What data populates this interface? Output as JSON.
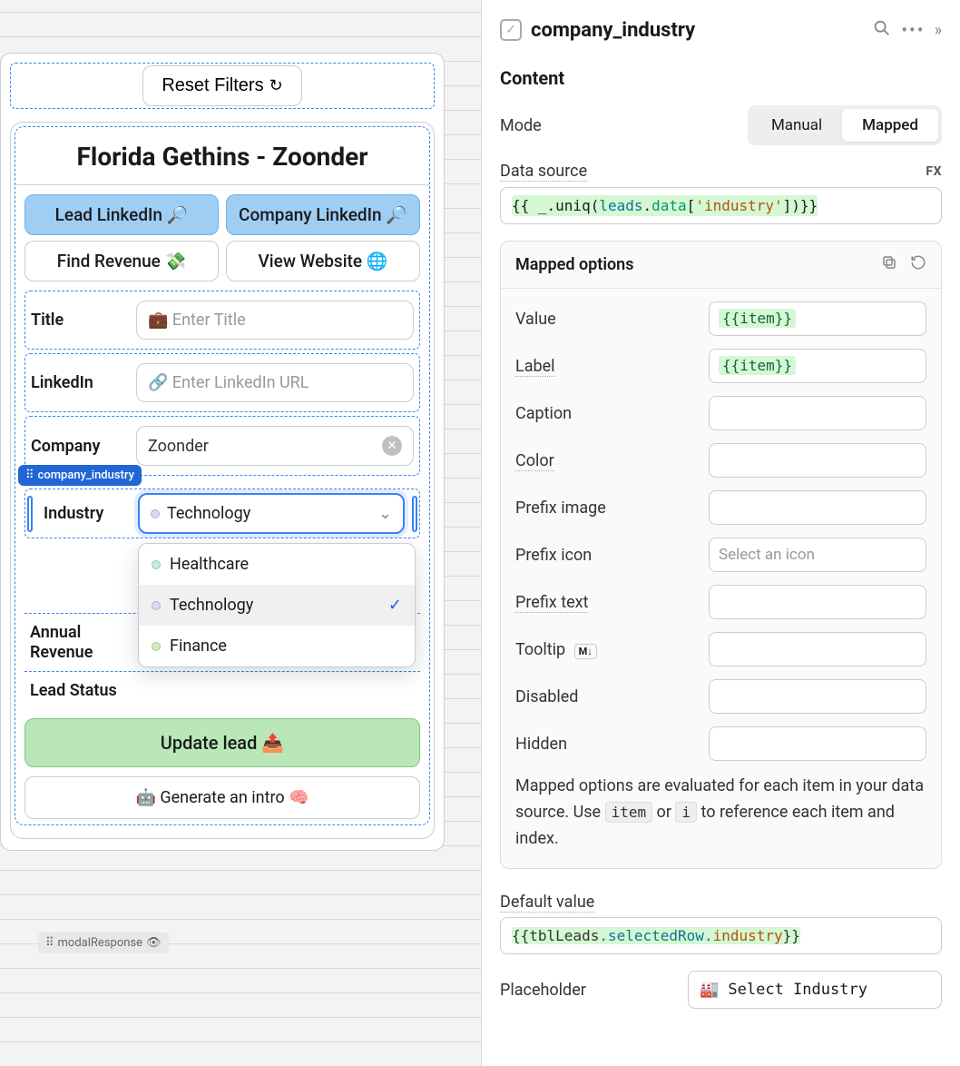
{
  "left": {
    "reset_label": "Reset Filters",
    "card_title": "Florida Gethins - Zoonder",
    "buttons": {
      "lead_linkedin": "Lead LinkedIn 🔎",
      "company_linkedin": "Company LinkedIn 🔎",
      "find_revenue": "Find Revenue 💸",
      "view_website": "View Website 🌐"
    },
    "fields": {
      "title_label": "Title",
      "title_placeholder": "💼 Enter Title",
      "linkedin_label": "LinkedIn",
      "linkedin_placeholder": "🔗 Enter LinkedIn URL",
      "company_label": "Company",
      "company_value": "Zoonder",
      "industry_label": "Industry",
      "industry_value": "Technology",
      "industry_options": [
        "Healthcare",
        "Technology",
        "Finance"
      ],
      "industry_selected": "Technology",
      "annual_revenue_label": "Annual Revenue",
      "lead_status_label": "Lead Status"
    },
    "selected_component_tag": "company_industry",
    "update_label": "Update lead 📤",
    "generate_label": "🤖 Generate an intro 🧠",
    "modal_tag": "modalResponse"
  },
  "right": {
    "title": "company_industry",
    "content_heading": "Content",
    "mode_label": "Mode",
    "mode_options": [
      "Manual",
      "Mapped"
    ],
    "mode_selected": "Mapped",
    "data_source_label": "Data source",
    "fx_label": "FX",
    "data_source_expr": "{{ _.uniq(leads.data['industry'])}}",
    "mapped_header": "Mapped options",
    "mapped": {
      "value_label": "Value",
      "value_expr": "{{item}}",
      "label_label": "Label",
      "label_expr": "{{item}}",
      "caption_label": "Caption",
      "color_label": "Color",
      "prefix_image_label": "Prefix image",
      "prefix_icon_label": "Prefix icon",
      "prefix_icon_placeholder": "Select an icon",
      "prefix_text_label": "Prefix text",
      "tooltip_label": "Tooltip",
      "tooltip_badge": "M↓",
      "disabled_label": "Disabled",
      "hidden_label": "Hidden"
    },
    "help_text_1": "Mapped options are evaluated for each item in your data source. Use ",
    "help_code_1": "item",
    "help_text_2": " or ",
    "help_code_2": "i",
    "help_text_3": " to reference each item and index.",
    "default_value_label": "Default value",
    "default_value_expr_parts": [
      "{{",
      "tblLeads",
      ".",
      "selectedRow",
      ".",
      "industry",
      "}}"
    ],
    "placeholder_label": "Placeholder",
    "placeholder_value": "🏭 Select Industry"
  }
}
